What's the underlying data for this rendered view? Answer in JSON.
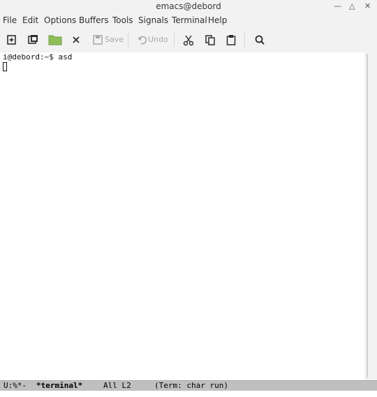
{
  "window": {
    "title": "emacs@debord"
  },
  "menu": [
    "File",
    "Edit",
    "Options",
    "Buffers",
    "Tools",
    "Signals",
    "Terminal",
    "Help"
  ],
  "toolbar": {
    "save_label": "Save",
    "undo_label": "Undo"
  },
  "icons": [
    "new-file-icon",
    "open-directory-icon",
    "folder-icon",
    "close-icon",
    "save-icon",
    "undo-icon",
    "cut-icon",
    "copy-icon",
    "paste-icon",
    "search-icon"
  ],
  "terminal": {
    "prompt": "i@debord:~$ asd"
  },
  "modeline": {
    "status": "U:%*-",
    "buffer": "*terminal*",
    "position": "All L2",
    "mode": "(Term: char run)"
  },
  "colors": {
    "folder": "#8fbf5a",
    "modeline_bg": "#bfbfbf"
  }
}
